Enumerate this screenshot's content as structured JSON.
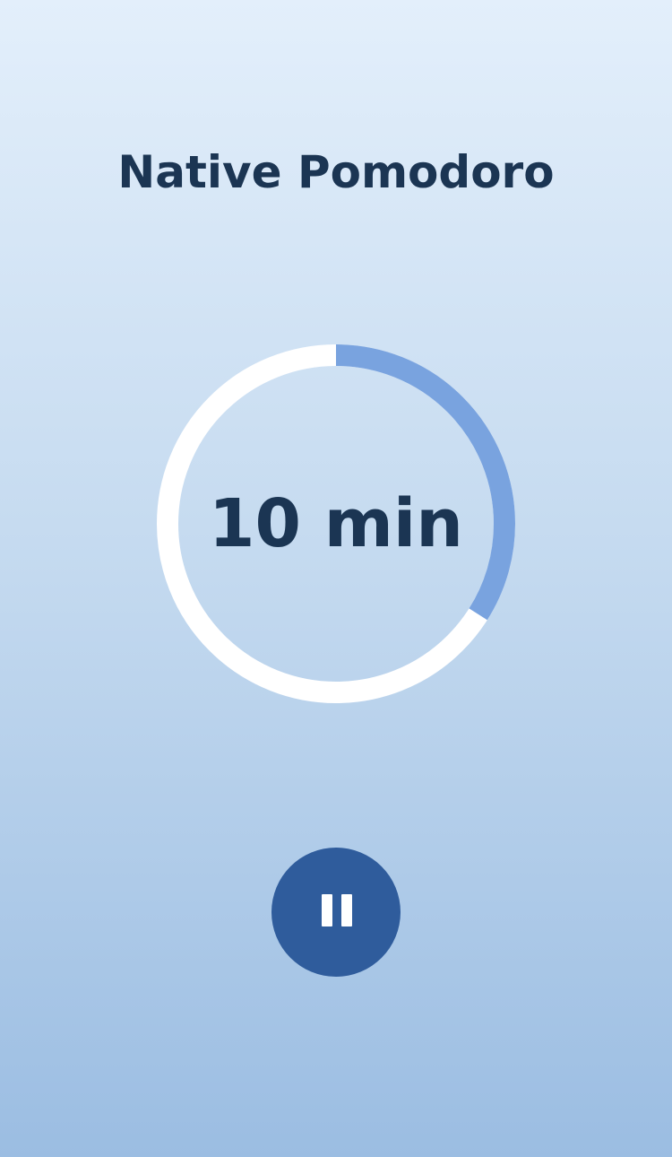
{
  "app": {
    "title": "Native Pomodoro"
  },
  "timer": {
    "display": "10 min",
    "progress_fraction": 0.34,
    "track_color": "#ffffff",
    "progress_color": "#79a3df"
  },
  "controls": {
    "pause_icon": "pause-icon",
    "button_color": "#2f5c9c"
  }
}
